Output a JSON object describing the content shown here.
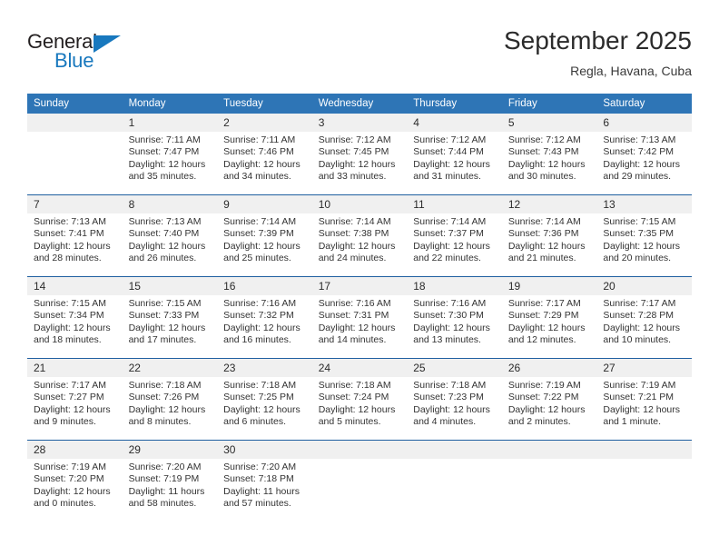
{
  "brand": {
    "name_top": "General",
    "name_bottom": "Blue",
    "color_black": "#231f20",
    "color_blue": "#1878be"
  },
  "header": {
    "title": "September 2025",
    "subtitle": "Regla, Havana, Cuba"
  },
  "theme": {
    "header_blue": "#2e75b6",
    "separator_blue": "#1f5fa0",
    "number_band_gray": "#f0f0f0",
    "text": "#333333"
  },
  "weekdays": [
    "Sunday",
    "Monday",
    "Tuesday",
    "Wednesday",
    "Thursday",
    "Friday",
    "Saturday"
  ],
  "weeks": [
    {
      "days": [
        {
          "num": "",
          "sunrise": "",
          "sunset": "",
          "daylight1": "",
          "daylight2": ""
        },
        {
          "num": "1",
          "sunrise": "Sunrise: 7:11 AM",
          "sunset": "Sunset: 7:47 PM",
          "daylight1": "Daylight: 12 hours",
          "daylight2": "and 35 minutes."
        },
        {
          "num": "2",
          "sunrise": "Sunrise: 7:11 AM",
          "sunset": "Sunset: 7:46 PM",
          "daylight1": "Daylight: 12 hours",
          "daylight2": "and 34 minutes."
        },
        {
          "num": "3",
          "sunrise": "Sunrise: 7:12 AM",
          "sunset": "Sunset: 7:45 PM",
          "daylight1": "Daylight: 12 hours",
          "daylight2": "and 33 minutes."
        },
        {
          "num": "4",
          "sunrise": "Sunrise: 7:12 AM",
          "sunset": "Sunset: 7:44 PM",
          "daylight1": "Daylight: 12 hours",
          "daylight2": "and 31 minutes."
        },
        {
          "num": "5",
          "sunrise": "Sunrise: 7:12 AM",
          "sunset": "Sunset: 7:43 PM",
          "daylight1": "Daylight: 12 hours",
          "daylight2": "and 30 minutes."
        },
        {
          "num": "6",
          "sunrise": "Sunrise: 7:13 AM",
          "sunset": "Sunset: 7:42 PM",
          "daylight1": "Daylight: 12 hours",
          "daylight2": "and 29 minutes."
        }
      ]
    },
    {
      "days": [
        {
          "num": "7",
          "sunrise": "Sunrise: 7:13 AM",
          "sunset": "Sunset: 7:41 PM",
          "daylight1": "Daylight: 12 hours",
          "daylight2": "and 28 minutes."
        },
        {
          "num": "8",
          "sunrise": "Sunrise: 7:13 AM",
          "sunset": "Sunset: 7:40 PM",
          "daylight1": "Daylight: 12 hours",
          "daylight2": "and 26 minutes."
        },
        {
          "num": "9",
          "sunrise": "Sunrise: 7:14 AM",
          "sunset": "Sunset: 7:39 PM",
          "daylight1": "Daylight: 12 hours",
          "daylight2": "and 25 minutes."
        },
        {
          "num": "10",
          "sunrise": "Sunrise: 7:14 AM",
          "sunset": "Sunset: 7:38 PM",
          "daylight1": "Daylight: 12 hours",
          "daylight2": "and 24 minutes."
        },
        {
          "num": "11",
          "sunrise": "Sunrise: 7:14 AM",
          "sunset": "Sunset: 7:37 PM",
          "daylight1": "Daylight: 12 hours",
          "daylight2": "and 22 minutes."
        },
        {
          "num": "12",
          "sunrise": "Sunrise: 7:14 AM",
          "sunset": "Sunset: 7:36 PM",
          "daylight1": "Daylight: 12 hours",
          "daylight2": "and 21 minutes."
        },
        {
          "num": "13",
          "sunrise": "Sunrise: 7:15 AM",
          "sunset": "Sunset: 7:35 PM",
          "daylight1": "Daylight: 12 hours",
          "daylight2": "and 20 minutes."
        }
      ]
    },
    {
      "days": [
        {
          "num": "14",
          "sunrise": "Sunrise: 7:15 AM",
          "sunset": "Sunset: 7:34 PM",
          "daylight1": "Daylight: 12 hours",
          "daylight2": "and 18 minutes."
        },
        {
          "num": "15",
          "sunrise": "Sunrise: 7:15 AM",
          "sunset": "Sunset: 7:33 PM",
          "daylight1": "Daylight: 12 hours",
          "daylight2": "and 17 minutes."
        },
        {
          "num": "16",
          "sunrise": "Sunrise: 7:16 AM",
          "sunset": "Sunset: 7:32 PM",
          "daylight1": "Daylight: 12 hours",
          "daylight2": "and 16 minutes."
        },
        {
          "num": "17",
          "sunrise": "Sunrise: 7:16 AM",
          "sunset": "Sunset: 7:31 PM",
          "daylight1": "Daylight: 12 hours",
          "daylight2": "and 14 minutes."
        },
        {
          "num": "18",
          "sunrise": "Sunrise: 7:16 AM",
          "sunset": "Sunset: 7:30 PM",
          "daylight1": "Daylight: 12 hours",
          "daylight2": "and 13 minutes."
        },
        {
          "num": "19",
          "sunrise": "Sunrise: 7:17 AM",
          "sunset": "Sunset: 7:29 PM",
          "daylight1": "Daylight: 12 hours",
          "daylight2": "and 12 minutes."
        },
        {
          "num": "20",
          "sunrise": "Sunrise: 7:17 AM",
          "sunset": "Sunset: 7:28 PM",
          "daylight1": "Daylight: 12 hours",
          "daylight2": "and 10 minutes."
        }
      ]
    },
    {
      "days": [
        {
          "num": "21",
          "sunrise": "Sunrise: 7:17 AM",
          "sunset": "Sunset: 7:27 PM",
          "daylight1": "Daylight: 12 hours",
          "daylight2": "and 9 minutes."
        },
        {
          "num": "22",
          "sunrise": "Sunrise: 7:18 AM",
          "sunset": "Sunset: 7:26 PM",
          "daylight1": "Daylight: 12 hours",
          "daylight2": "and 8 minutes."
        },
        {
          "num": "23",
          "sunrise": "Sunrise: 7:18 AM",
          "sunset": "Sunset: 7:25 PM",
          "daylight1": "Daylight: 12 hours",
          "daylight2": "and 6 minutes."
        },
        {
          "num": "24",
          "sunrise": "Sunrise: 7:18 AM",
          "sunset": "Sunset: 7:24 PM",
          "daylight1": "Daylight: 12 hours",
          "daylight2": "and 5 minutes."
        },
        {
          "num": "25",
          "sunrise": "Sunrise: 7:18 AM",
          "sunset": "Sunset: 7:23 PM",
          "daylight1": "Daylight: 12 hours",
          "daylight2": "and 4 minutes."
        },
        {
          "num": "26",
          "sunrise": "Sunrise: 7:19 AM",
          "sunset": "Sunset: 7:22 PM",
          "daylight1": "Daylight: 12 hours",
          "daylight2": "and 2 minutes."
        },
        {
          "num": "27",
          "sunrise": "Sunrise: 7:19 AM",
          "sunset": "Sunset: 7:21 PM",
          "daylight1": "Daylight: 12 hours",
          "daylight2": "and 1 minute."
        }
      ]
    },
    {
      "days": [
        {
          "num": "28",
          "sunrise": "Sunrise: 7:19 AM",
          "sunset": "Sunset: 7:20 PM",
          "daylight1": "Daylight: 12 hours",
          "daylight2": "and 0 minutes."
        },
        {
          "num": "29",
          "sunrise": "Sunrise: 7:20 AM",
          "sunset": "Sunset: 7:19 PM",
          "daylight1": "Daylight: 11 hours",
          "daylight2": "and 58 minutes."
        },
        {
          "num": "30",
          "sunrise": "Sunrise: 7:20 AM",
          "sunset": "Sunset: 7:18 PM",
          "daylight1": "Daylight: 11 hours",
          "daylight2": "and 57 minutes."
        },
        {
          "num": "",
          "sunrise": "",
          "sunset": "",
          "daylight1": "",
          "daylight2": ""
        },
        {
          "num": "",
          "sunrise": "",
          "sunset": "",
          "daylight1": "",
          "daylight2": ""
        },
        {
          "num": "",
          "sunrise": "",
          "sunset": "",
          "daylight1": "",
          "daylight2": ""
        },
        {
          "num": "",
          "sunrise": "",
          "sunset": "",
          "daylight1": "",
          "daylight2": ""
        }
      ]
    }
  ]
}
